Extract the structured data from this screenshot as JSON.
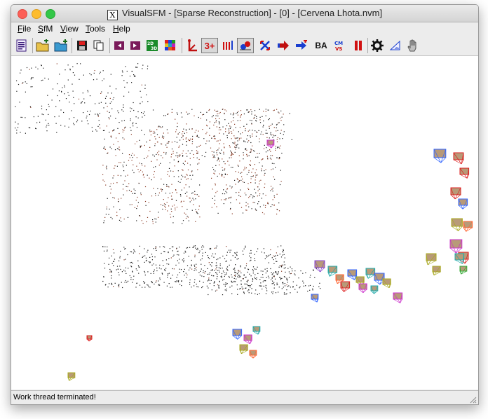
{
  "window": {
    "title": "VisualSFM - [Sparse Reconstruction] - [0] - [Cervena Lhota.nvm]",
    "app_icon_glyph": "X"
  },
  "menu": [
    {
      "label": "File",
      "underline": "F",
      "rest": "ile"
    },
    {
      "label": "SfM",
      "underline": "S",
      "rest": "fM"
    },
    {
      "label": "View",
      "underline": "V",
      "rest": "iew"
    },
    {
      "label": "Tools",
      "underline": "T",
      "rest": "ools"
    },
    {
      "label": "Help",
      "underline": "H",
      "rest": "elp"
    }
  ],
  "toolbar": {
    "text_buttons": {
      "three_plus": "3+",
      "ba": "BA",
      "cmvs": "CMVS"
    },
    "buttons": [
      "log-window-icon",
      "open-multi-images-icon",
      "add-images-icon",
      "save-nvm-icon",
      "copy-icon",
      "show-thumbnails-icon",
      "show-single-image-icon",
      "show-match-matrix-icon",
      "show-feature-icon",
      "compute-missing-match-icon",
      "reconstruct-3plus-icon",
      "compute-3d-reconstruction-bars-icon",
      "show-3d-points-icon",
      "reconstruction-view-icon",
      "run-sfm-arrow-icon",
      "add-model-icon",
      "bundle-adjustment-icon",
      "dense-cmvs-icon",
      "pause-icon",
      "settings-gear-icon",
      "edit-ruler-icon",
      "pan-hand-icon"
    ],
    "pressed": [
      "reconstruct-3plus-icon",
      "show-3d-points-icon"
    ]
  },
  "canvas": {
    "description_free": true
  },
  "status": {
    "text": "Work thread terminated!"
  },
  "colors": {
    "accent_red": "#d01010",
    "accent_blue": "#1a3fcf",
    "point_dark": "#1a1a1a",
    "point_brown": "#8a3a24"
  }
}
